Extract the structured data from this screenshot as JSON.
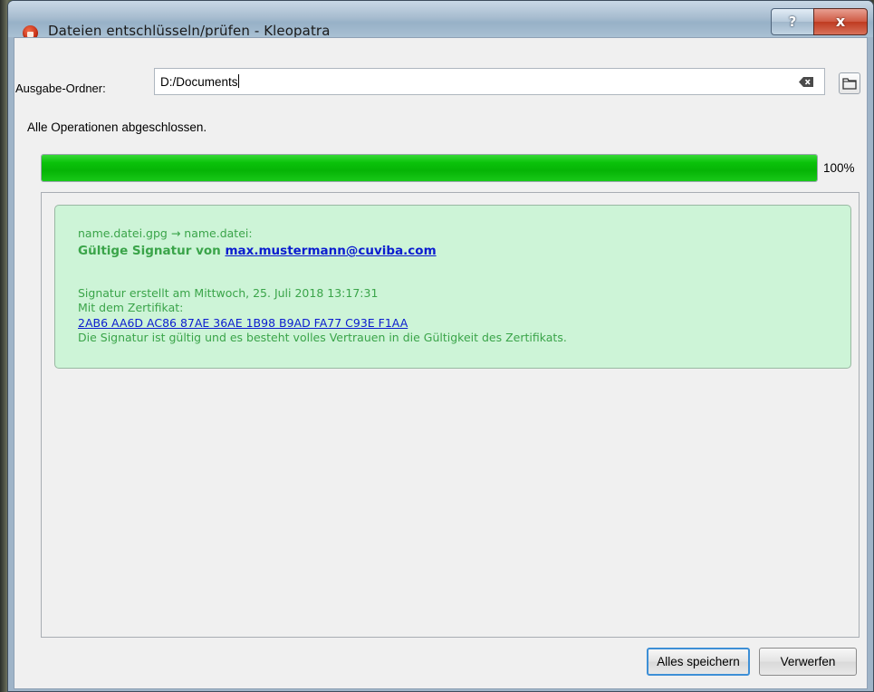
{
  "window": {
    "title": "Dateien entschlüsseln/prüfen - Kleopatra",
    "help_label": "?",
    "close_label": "x"
  },
  "output": {
    "label": "Ausgabe-Ordner:",
    "value": "D:/Documents"
  },
  "status": "Alle Operationen abgeschlossen.",
  "progress": {
    "percent": 100,
    "label": "100%"
  },
  "result": {
    "file_line": "name.datei.gpg → name.datei:",
    "valid_prefix": "Gültige Signatur von",
    "signer_email": "max.mustermann@cuviba.com",
    "created_line": "Signatur erstellt am Mittwoch, 25. Juli 2018 13:17:31",
    "cert_label": "Mit dem Zertifikat:",
    "fingerprint": "2AB6 AA6D AC86 87AE 36AE 1B98 B9AD FA77 C93E F1AA",
    "trust_line": "Die Signatur ist gültig und es besteht volles Vertrauen in die Gültigkeit des Zertifikats.",
    "background_color": "#cdf4d7",
    "text_color": "#3aa449"
  },
  "buttons": {
    "save_all": "Alles speichern",
    "discard": "Verwerfen"
  },
  "icons": {
    "app": "kleopatra-app-icon",
    "clear": "clear-input-icon",
    "folder": "folder-icon"
  }
}
